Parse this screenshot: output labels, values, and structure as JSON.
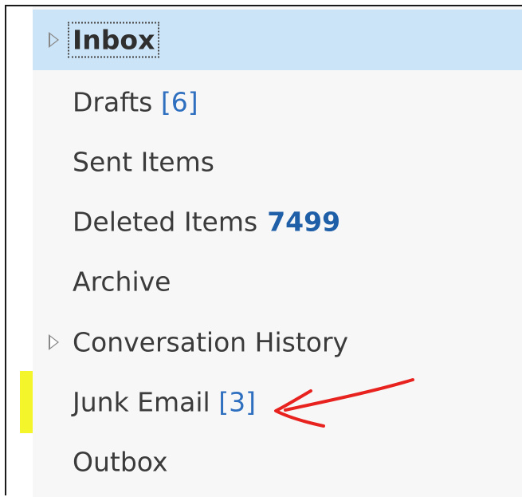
{
  "folders": [
    {
      "name": "Inbox",
      "count": "",
      "count_style": "none",
      "expandable": true,
      "selected": true
    },
    {
      "name": "Drafts",
      "count": "[6]",
      "count_style": "bracket",
      "expandable": false,
      "selected": false
    },
    {
      "name": "Sent Items",
      "count": "",
      "count_style": "none",
      "expandable": false,
      "selected": false
    },
    {
      "name": "Deleted Items",
      "count": "7499",
      "count_style": "bold",
      "expandable": false,
      "selected": false
    },
    {
      "name": "Archive",
      "count": "",
      "count_style": "none",
      "expandable": false,
      "selected": false
    },
    {
      "name": "Conversation History",
      "count": "",
      "count_style": "none",
      "expandable": true,
      "selected": false
    },
    {
      "name": "Junk Email",
      "count": "[3]",
      "count_style": "bracket",
      "expandable": false,
      "selected": false
    },
    {
      "name": "Outbox",
      "count": "",
      "count_style": "none",
      "expandable": false,
      "selected": false
    }
  ],
  "annotation": {
    "highlight_color": "#f4f62b",
    "highlighted_folder": "Junk Email",
    "arrow_color": "#e8231f"
  },
  "colors": {
    "selected_bg": "#cce4f7",
    "unread_count": "#1f5fa8",
    "item_count": "#2f6fbf",
    "pane_bg": "#f7f7f7"
  }
}
